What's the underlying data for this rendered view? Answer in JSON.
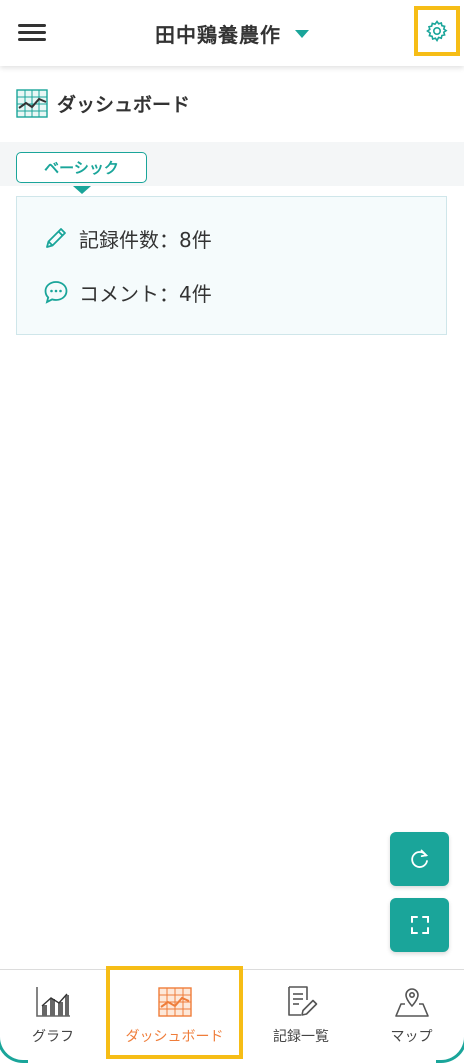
{
  "header": {
    "title": "田中鶏養農作",
    "menu_icon": "hamburger-menu-icon",
    "dropdown_icon": "caret-down-icon",
    "settings_icon": "gear-icon"
  },
  "page": {
    "title": "ダッシュボード",
    "title_icon": "dashboard-chart-icon"
  },
  "tabs": [
    {
      "label": "ベーシック",
      "active": true
    }
  ],
  "stats": [
    {
      "icon": "pencil-icon",
      "label": "記録件数：8件"
    },
    {
      "icon": "comment-icon",
      "label": "コメント：4件"
    }
  ],
  "fabs": [
    {
      "icon": "refresh-icon"
    },
    {
      "icon": "fullscreen-icon"
    }
  ],
  "bottom_nav": [
    {
      "label": "グラフ",
      "icon": "bar-chart-icon",
      "active": false
    },
    {
      "label": "ダッシュボード",
      "icon": "dashboard-chart-icon",
      "active": true
    },
    {
      "label": "記録一覧",
      "icon": "record-list-icon",
      "active": false
    },
    {
      "label": "マップ",
      "icon": "map-pin-icon",
      "active": false
    }
  ],
  "colors": {
    "accent": "#1aa59a",
    "highlight": "#f6bd16",
    "active_nav": "#ef7d3a"
  }
}
